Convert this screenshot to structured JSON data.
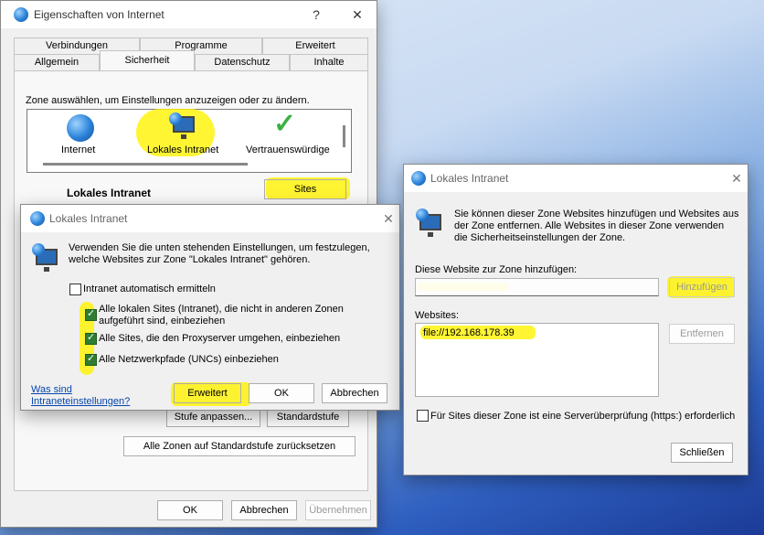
{
  "main_window": {
    "title": "Eigenschaften von Internet",
    "help_glyph": "?",
    "close_glyph": "✕",
    "tabs_row1": [
      "Verbindungen",
      "Programme",
      "Erweitert"
    ],
    "tabs_row2": [
      "Allgemein",
      "Sicherheit",
      "Datenschutz",
      "Inhalte"
    ],
    "zone_prompt": "Zone auswählen, um Einstellungen anzuzeigen oder zu ändern.",
    "zones": [
      {
        "label": "Internet",
        "icon": "globe-icon"
      },
      {
        "label": "Lokales Intranet",
        "icon": "intranet-icon"
      },
      {
        "label": "Vertrauenswürdige",
        "icon": "checkmark-icon"
      }
    ],
    "zone_title": "Lokales Intranet",
    "sites_button": "Sites",
    "custom_level_button": "Stufe anpassen...",
    "default_level_button": "Standardstufe",
    "reset_all_button": "Alle Zonen auf Standardstufe zurücksetzen",
    "ok": "OK",
    "cancel": "Abbrechen",
    "apply": "Übernehmen"
  },
  "intranet_dialog": {
    "title": "Lokales Intranet",
    "close_glyph": "✕",
    "description": "Verwenden Sie die unten stehenden Einstellungen, um festzulegen, welche Websites zur Zone \"Lokales Intranet\" gehören.",
    "auto_detect": {
      "label": "Intranet automatisch ermitteln",
      "checked": false
    },
    "options": [
      {
        "label": "Alle lokalen Sites (Intranet), die nicht in anderen Zonen aufgeführt sind, einbeziehen",
        "checked": true
      },
      {
        "label": "Alle Sites, die den Proxyserver umgehen, einbeziehen",
        "checked": true
      },
      {
        "label": "Alle Netzwerkpfade (UNCs) einbeziehen",
        "checked": true
      }
    ],
    "help_link": "Was sind Intraneteinstellungen?",
    "advanced": "Erweitert",
    "ok": "OK",
    "cancel": "Abbrechen"
  },
  "sites_dialog": {
    "title": "Lokales Intranet",
    "close_glyph": "✕",
    "description": "Sie können dieser Zone Websites hinzufügen und Websites aus der Zone entfernen. Alle Websites in dieser Zone verwenden die Sicherheitseinstellungen der Zone.",
    "add_label": "Diese Website zur Zone hinzufügen:",
    "add_input_value": "",
    "add_button": "Hinzufügen",
    "websites_label": "Websites:",
    "websites": [
      "file://192.168.178.39"
    ],
    "remove_button": "Entfernen",
    "https_required": {
      "label": "Für Sites dieser Zone ist eine Serverüberprüfung (https:) erforderlich",
      "checked": false
    },
    "close_button": "Schließen"
  },
  "colors": {
    "highlight": "#fff200",
    "accent": "#2a82d8",
    "check": "#2e7d32"
  }
}
